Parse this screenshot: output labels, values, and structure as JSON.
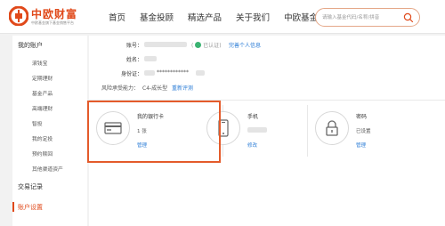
{
  "brand": {
    "name": "中欧财富",
    "subtitle": "中欧基金旗下基金销售平台",
    "color": "#e0491a"
  },
  "nav": {
    "items": [
      "首页",
      "基金投顾",
      "精选产品",
      "关于我们",
      "中欧基金"
    ]
  },
  "search": {
    "placeholder": "请输入基金代码/名称/拼音"
  },
  "sidebar": {
    "account_title": "我的账户",
    "items": [
      "滚钱宝",
      "定期理财",
      "基金产品",
      "高端理财",
      "智投",
      "我的定投",
      "预约赎回",
      "其他渠道资产"
    ],
    "records": "交易记录",
    "settings": "账户设置"
  },
  "account": {
    "account_label": "账号：",
    "verified_text": "已认证",
    "complete_info": "完善个人信息",
    "name_label": "姓名：",
    "id_label": "身份证：",
    "id_masked": "************",
    "risk_label": "风险承受能力：",
    "risk_value": "C4-成长型",
    "reassess": "重新评测"
  },
  "cards": {
    "bank": {
      "title": "我的银行卡",
      "value": "1 张",
      "action": "管理"
    },
    "phone": {
      "title": "手机",
      "action": "修改"
    },
    "password": {
      "title": "密码",
      "value": "已设置",
      "action": "管理"
    }
  }
}
